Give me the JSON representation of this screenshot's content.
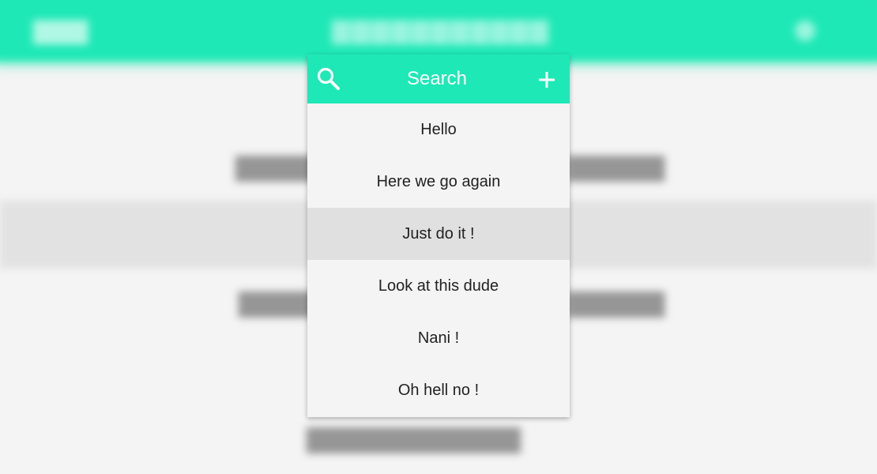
{
  "colors": {
    "accent": "#1ee8b6",
    "page_background": "#f4f4f4",
    "selected_background": "#e0e0e0",
    "text": "#222222"
  },
  "dropdown": {
    "search": {
      "placeholder": "Search",
      "value": ""
    },
    "search_icon": "search-icon",
    "add_icon": "plus-icon",
    "items": [
      {
        "label": "Hello",
        "selected": false
      },
      {
        "label": "Here we go again",
        "selected": false
      },
      {
        "label": "Just do it !",
        "selected": true
      },
      {
        "label": "Look at this dude",
        "selected": false
      },
      {
        "label": "Nani !",
        "selected": false
      },
      {
        "label": "Oh hell no !",
        "selected": false
      }
    ]
  }
}
